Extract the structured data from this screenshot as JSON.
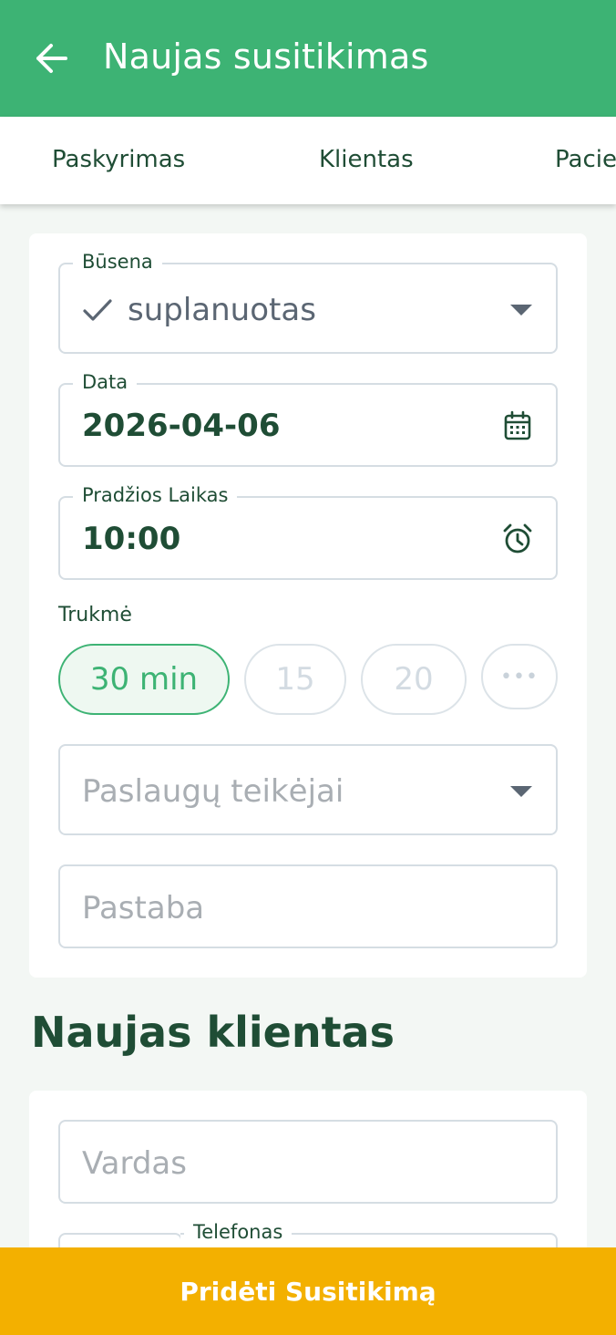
{
  "header": {
    "title": "Naujas susitikimas"
  },
  "tabs": [
    {
      "label": "Paskyrimas"
    },
    {
      "label": "Klientas"
    },
    {
      "label": "Pacie"
    }
  ],
  "appointment": {
    "status": {
      "label": "Būsena",
      "value": "suplanuotas"
    },
    "date": {
      "label": "Data",
      "value": "2026-04-06"
    },
    "start_time": {
      "label": "Pradžios Laikas",
      "value": "10:00"
    },
    "duration": {
      "label": "Trukmė",
      "options": [
        "30 min",
        "15",
        "20",
        "•••"
      ],
      "selected": "30 min"
    },
    "providers": {
      "placeholder": "Paslaugų teikėjai"
    },
    "note": {
      "placeholder": "Pastaba"
    }
  },
  "new_client": {
    "heading": "Naujas klientas",
    "name": {
      "placeholder": "Vardas"
    },
    "phone": {
      "label": "Telefonas"
    }
  },
  "cta": {
    "label": "Pridėti Susitikimą"
  },
  "colors": {
    "primary_green": "#3db374",
    "dark_green": "#1f4d35",
    "cta_yellow": "#f3b000"
  }
}
